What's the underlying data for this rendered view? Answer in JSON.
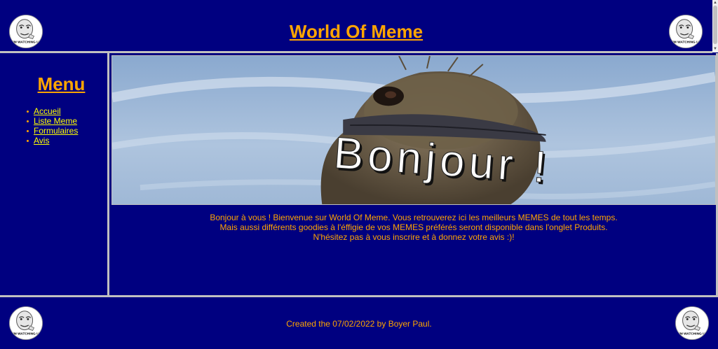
{
  "header": {
    "title": "World Of Meme"
  },
  "badge": {
    "caption": "IM WATCHING U"
  },
  "sidebar": {
    "title": "Menu",
    "items": [
      {
        "label": "Accueil"
      },
      {
        "label": "Liste Meme"
      },
      {
        "label": "Formulaires"
      },
      {
        "label": "Avis"
      }
    ]
  },
  "hero": {
    "text": "Bonjour !"
  },
  "welcome": {
    "line1": "Bonjour à vous ! Bienvenue sur World Of Meme. Vous retrouverez ici les meilleurs MEMES de tout les temps.",
    "line2": "Mais aussi différents goodies à l'éffigie de vos MEMES préférés seront disponible dans l'onglet Produits.",
    "line3": "N'hésitez pas à vous inscrire et à donnez votre avis :)!"
  },
  "footer": {
    "text": "Created the 07/02/2022 by Boyer Paul."
  },
  "colors": {
    "background": "#000080",
    "accent": "#ffa500",
    "link": "#ffff00",
    "divider": "#c0c0c0"
  }
}
